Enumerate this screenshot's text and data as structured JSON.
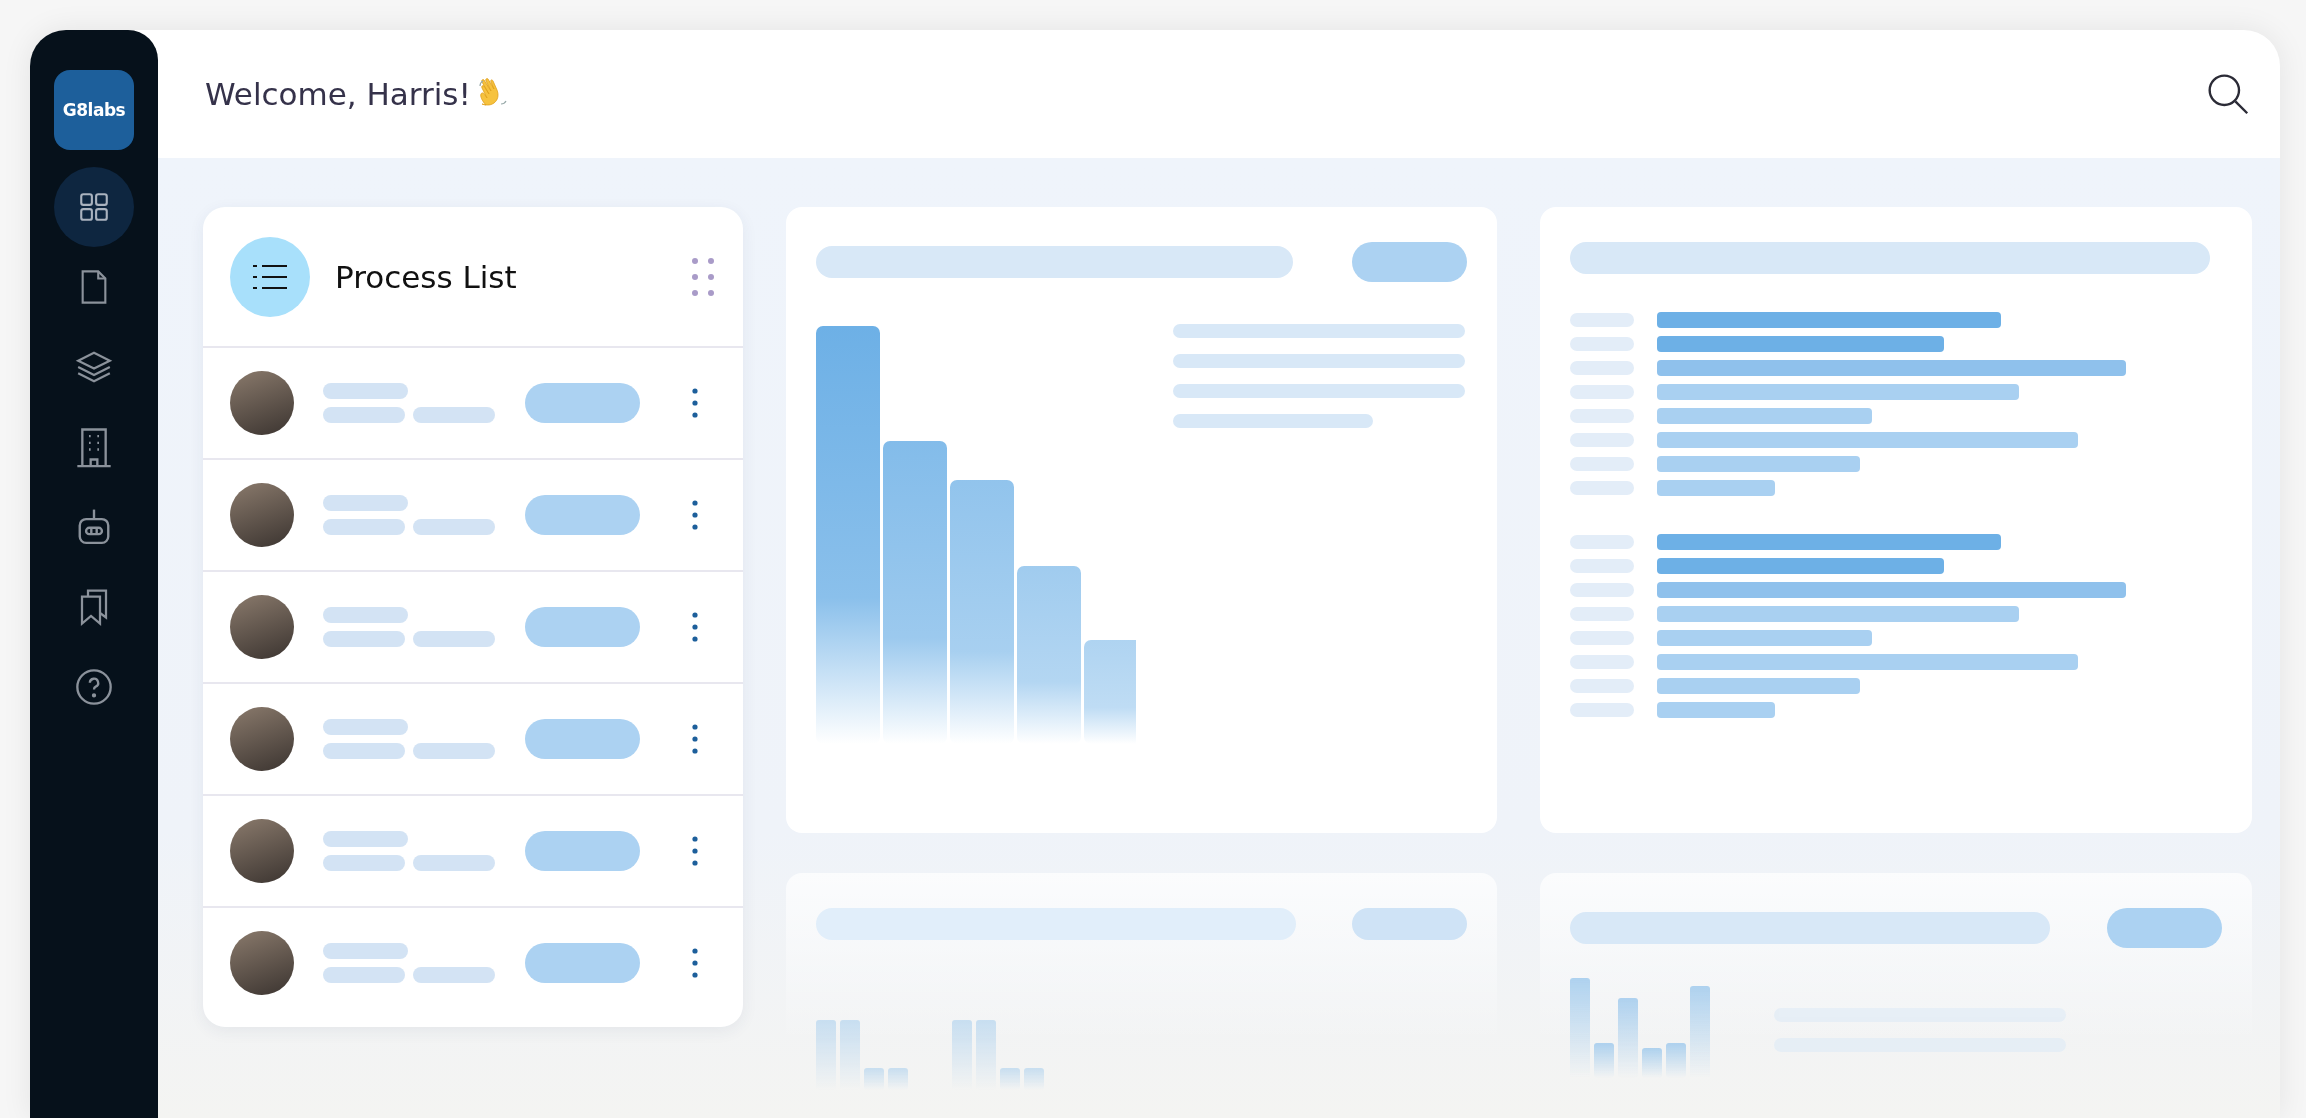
{
  "sidebar": {
    "logo": "G8labs",
    "items": [
      {
        "kind": "dashboard",
        "selected": true
      },
      {
        "kind": "document",
        "selected": false
      },
      {
        "kind": "layers",
        "selected": false
      },
      {
        "kind": "building",
        "selected": false
      },
      {
        "kind": "robot",
        "selected": false
      },
      {
        "kind": "bookmarks",
        "selected": false
      },
      {
        "kind": "help",
        "selected": false
      }
    ]
  },
  "header": {
    "greeting": "Welcome, Harris!"
  },
  "process_list": {
    "title": "Process List",
    "rows": [
      {
        "kind": "person"
      },
      {
        "kind": "person"
      },
      {
        "kind": "person"
      },
      {
        "kind": "person"
      },
      {
        "kind": "person"
      },
      {
        "kind": "person"
      }
    ]
  }
}
